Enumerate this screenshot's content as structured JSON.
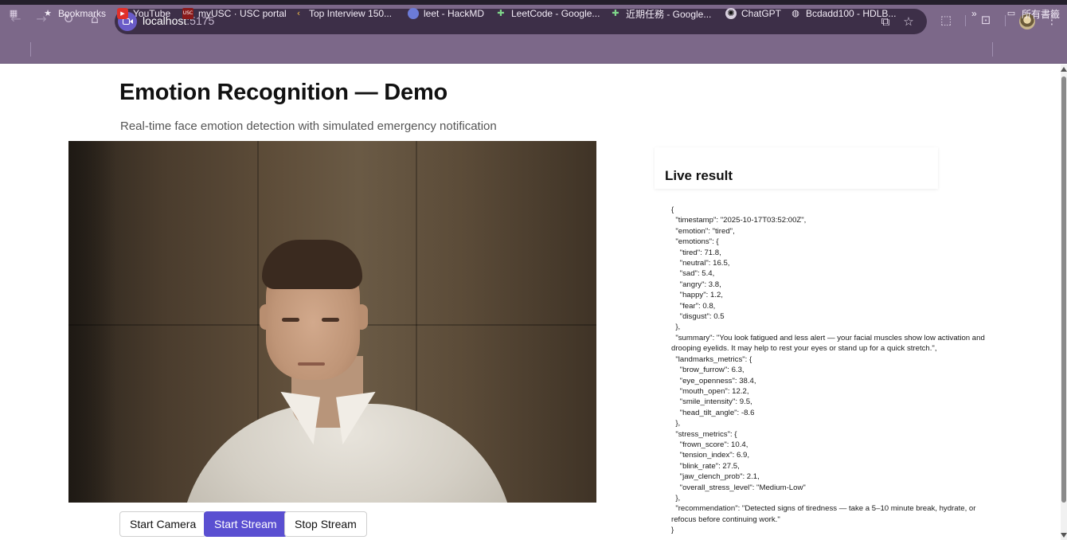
{
  "browser": {
    "url_host": "localhost",
    "url_port": ":5175",
    "bookmarks": [
      {
        "label": "Bookmarks",
        "icon": "star-icon"
      },
      {
        "label": "YouTube",
        "icon": "youtube-icon"
      },
      {
        "label": "myUSC · USC portal",
        "icon": "usc-icon"
      },
      {
        "label": "Top Interview 150...",
        "icon": "leetcode-icon"
      },
      {
        "label": "leet - HackMD",
        "icon": "hackmd-icon"
      },
      {
        "label": "LeetCode - Google...",
        "icon": "sheets-icon"
      },
      {
        "label": "近期任務 - Google...",
        "icon": "sheets-icon"
      },
      {
        "label": "ChatGPT",
        "icon": "openai-icon"
      },
      {
        "label": "Bcdadd100 - HDLB...",
        "icon": "globe-icon"
      }
    ],
    "other_bookmarks": "所有書籤",
    "overflow": "»"
  },
  "page": {
    "title": "Emotion Recognition — Demo",
    "subtitle": "Real-time face emotion detection with simulated emergency notification"
  },
  "controls": {
    "start_camera": "Start Camera",
    "start_stream": "Start Stream",
    "stop_stream": "Stop Stream"
  },
  "result": {
    "title": "Live result",
    "json_text": "{\n  \"timestamp\": \"2025-10-17T03:52:00Z\",\n  \"emotion\": \"tired\",\n  \"emotions\": {\n    \"tired\": 71.8,\n    \"neutral\": 16.5,\n    \"sad\": 5.4,\n    \"angry\": 3.8,\n    \"happy\": 1.2,\n    \"fear\": 0.8,\n    \"disgust\": 0.5\n  },\n  \"summary\": \"You look fatigued and less alert — your facial muscles show low activation and\ndrooping eyelids. It may help to rest your eyes or stand up for a quick stretch.\",\n  \"landmarks_metrics\": {\n    \"brow_furrow\": 6.3,\n    \"eye_openness\": 38.4,\n    \"mouth_open\": 12.2,\n    \"smile_intensity\": 9.5,\n    \"head_tilt_angle\": -8.6\n  },\n  \"stress_metrics\": {\n    \"frown_score\": 10.4,\n    \"tension_index\": 6.9,\n    \"blink_rate\": 27.5,\n    \"jaw_clench_prob\": 2.1,\n    \"overall_stress_level\": \"Medium-Low\"\n  },\n  \"recommendation\": \"Detected signs of tiredness — take a 5–10 minute break, hydrate, or\nrefocus before continuing work.\"\n}"
  },
  "colors": {
    "chrome": "#7c6889",
    "omnibox": "#3d2f48",
    "primary_button": "#5a4fd1"
  }
}
